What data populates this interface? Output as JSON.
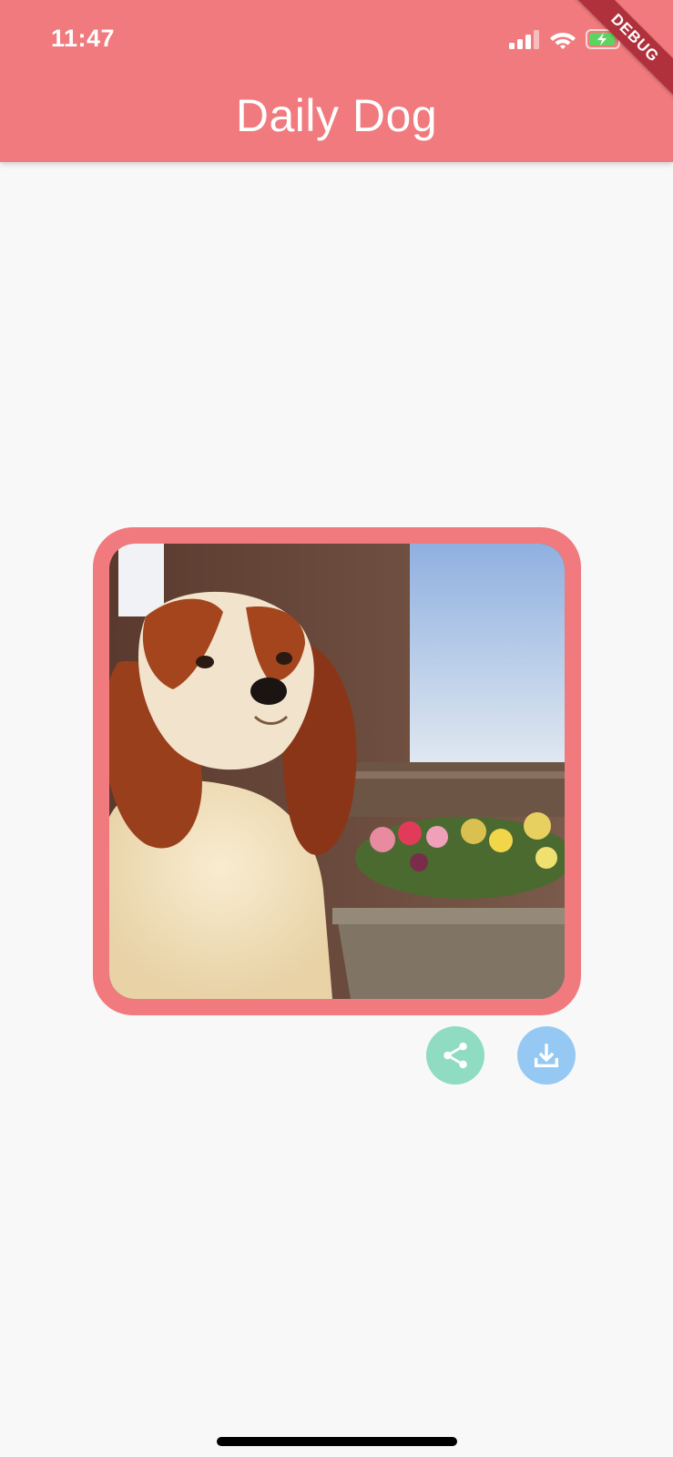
{
  "status_bar": {
    "time": "11:47",
    "icons": [
      "cellular-signal-icon",
      "wifi-icon",
      "battery-charging-icon"
    ]
  },
  "app_bar": {
    "title": "Daily Dog",
    "background_color": "#f07a7d"
  },
  "debug_banner": {
    "label": "DEBUG"
  },
  "dog_card": {
    "frame_color": "#f07a7d",
    "image_subject": "dog-photo-cavalier-king-charles-spaniel"
  },
  "actions": {
    "share": {
      "icon": "share-icon",
      "color": "#8fdcc2"
    },
    "download": {
      "icon": "download-icon",
      "color": "#95c9f3"
    }
  }
}
